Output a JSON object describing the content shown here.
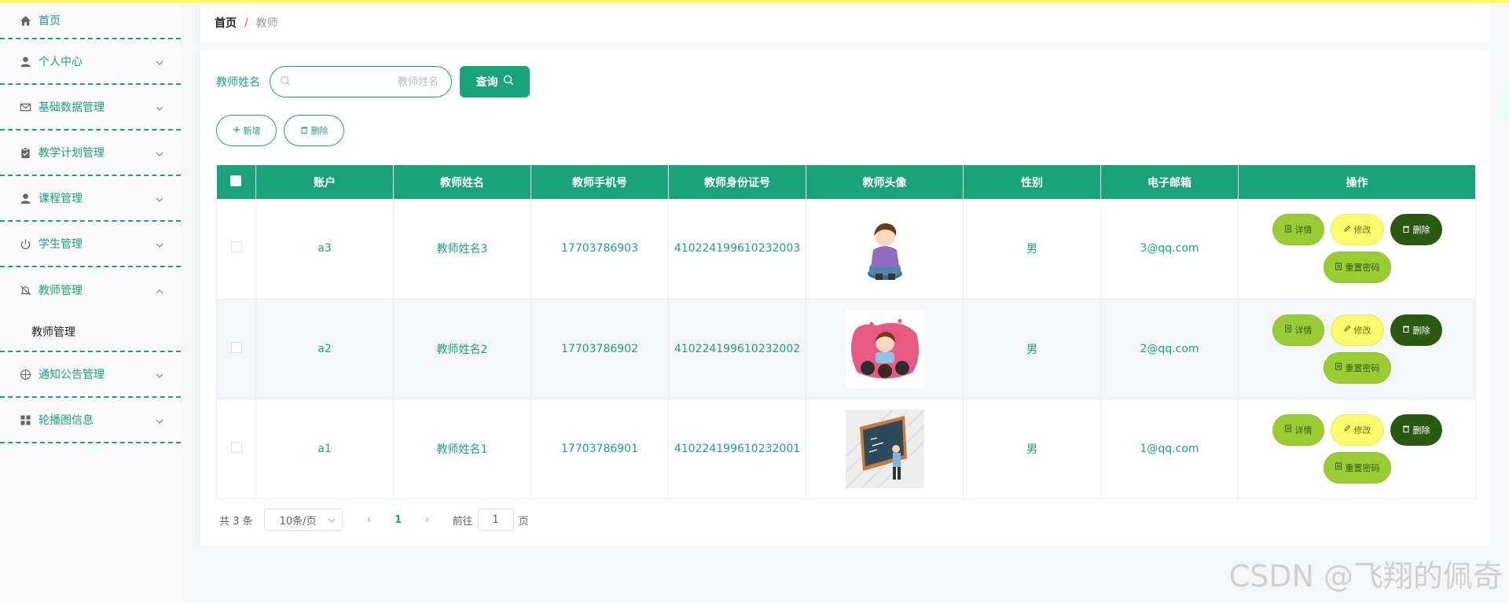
{
  "sidebar": {
    "items": [
      {
        "label": "首页",
        "icon": "home-icon"
      },
      {
        "label": "个人中心",
        "icon": "user-icon"
      },
      {
        "label": "基础数据管理",
        "icon": "mail-icon"
      },
      {
        "label": "教学计划管理",
        "icon": "clipboard-icon"
      },
      {
        "label": "课程管理",
        "icon": "user-icon"
      },
      {
        "label": "学生管理",
        "icon": "power-icon"
      },
      {
        "label": "教师管理",
        "icon": "bell-off-icon"
      },
      {
        "label": "通知公告管理",
        "icon": "compass-icon"
      },
      {
        "label": "轮播图信息",
        "icon": "grid-icon"
      }
    ],
    "submenu": {
      "label": "教师管理"
    }
  },
  "breadcrumb": {
    "home": "首页",
    "separator": "/",
    "current": "教师"
  },
  "search": {
    "label": "教师姓名",
    "placeholder": "教师姓名",
    "query_label": "查询"
  },
  "actions": {
    "add_label": "新增",
    "delete_label": "删除"
  },
  "table": {
    "columns": [
      "账户",
      "教师姓名",
      "教师手机号",
      "教师身份证号",
      "教师头像",
      "性别",
      "电子邮箱",
      "操作"
    ],
    "rows": [
      {
        "account": "a3",
        "name": "教师姓名3",
        "phone": "17703786903",
        "idcard": "410224199610232003",
        "gender": "男",
        "email": "3@qq.com"
      },
      {
        "account": "a2",
        "name": "教师姓名2",
        "phone": "17703786902",
        "idcard": "410224199610232002",
        "gender": "男",
        "email": "2@qq.com"
      },
      {
        "account": "a1",
        "name": "教师姓名1",
        "phone": "17703786901",
        "idcard": "410224199610232001",
        "gender": "男",
        "email": "1@qq.com"
      }
    ],
    "op_labels": {
      "detail": "详情",
      "edit": "修改",
      "delete": "删除",
      "reset": "重置密码"
    }
  },
  "pagination": {
    "total": "共 3 条",
    "page_size": "10条/页",
    "current_page": "1",
    "goto_prefix": "前往",
    "goto_value": "1",
    "goto_suffix": "页"
  },
  "watermark": "CSDN @飞翔的佩奇",
  "colors": {
    "accent": "#1aa37a",
    "top_bar": "#fff76b",
    "detail": "#9ccc34",
    "edit": "#fbfb6e",
    "delete": "#2a5a12"
  }
}
